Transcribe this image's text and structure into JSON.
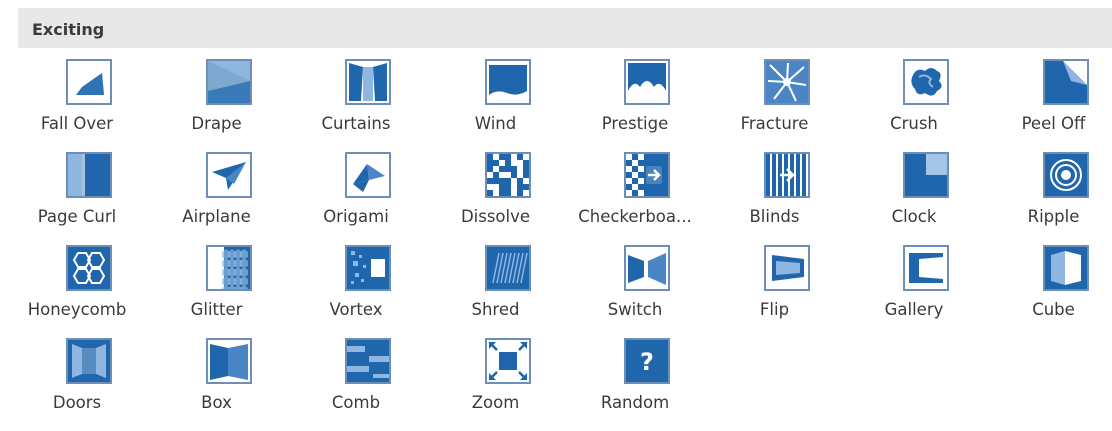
{
  "section": {
    "title": "Exciting"
  },
  "colors": {
    "accent": "#1f66ac",
    "light": "#8fb6e0",
    "mid": "#4a86c5",
    "frame": "#6d8fb7",
    "header_bg": "#e8e8e8"
  },
  "transitions": [
    {
      "label": "Fall Over",
      "icon": "fall-over-icon"
    },
    {
      "label": "Drape",
      "icon": "drape-icon"
    },
    {
      "label": "Curtains",
      "icon": "curtains-icon"
    },
    {
      "label": "Wind",
      "icon": "wind-icon"
    },
    {
      "label": "Prestige",
      "icon": "prestige-icon"
    },
    {
      "label": "Fracture",
      "icon": "fracture-icon"
    },
    {
      "label": "Crush",
      "icon": "crush-icon"
    },
    {
      "label": "Peel Off",
      "icon": "peel-off-icon"
    },
    {
      "label": "Page Curl",
      "icon": "page-curl-icon"
    },
    {
      "label": "Airplane",
      "icon": "airplane-icon"
    },
    {
      "label": "Origami",
      "icon": "origami-icon"
    },
    {
      "label": "Dissolve",
      "icon": "dissolve-icon"
    },
    {
      "label": "Checkerboa...",
      "icon": "checkerboard-icon"
    },
    {
      "label": "Blinds",
      "icon": "blinds-icon"
    },
    {
      "label": "Clock",
      "icon": "clock-icon"
    },
    {
      "label": "Ripple",
      "icon": "ripple-icon"
    },
    {
      "label": "Honeycomb",
      "icon": "honeycomb-icon"
    },
    {
      "label": "Glitter",
      "icon": "glitter-icon"
    },
    {
      "label": "Vortex",
      "icon": "vortex-icon"
    },
    {
      "label": "Shred",
      "icon": "shred-icon"
    },
    {
      "label": "Switch",
      "icon": "switch-icon"
    },
    {
      "label": "Flip",
      "icon": "flip-icon"
    },
    {
      "label": "Gallery",
      "icon": "gallery-icon"
    },
    {
      "label": "Cube",
      "icon": "cube-icon"
    },
    {
      "label": "Doors",
      "icon": "doors-icon"
    },
    {
      "label": "Box",
      "icon": "box-icon"
    },
    {
      "label": "Comb",
      "icon": "comb-icon"
    },
    {
      "label": "Zoom",
      "icon": "zoom-icon"
    },
    {
      "label": "Random",
      "icon": "random-icon"
    }
  ]
}
